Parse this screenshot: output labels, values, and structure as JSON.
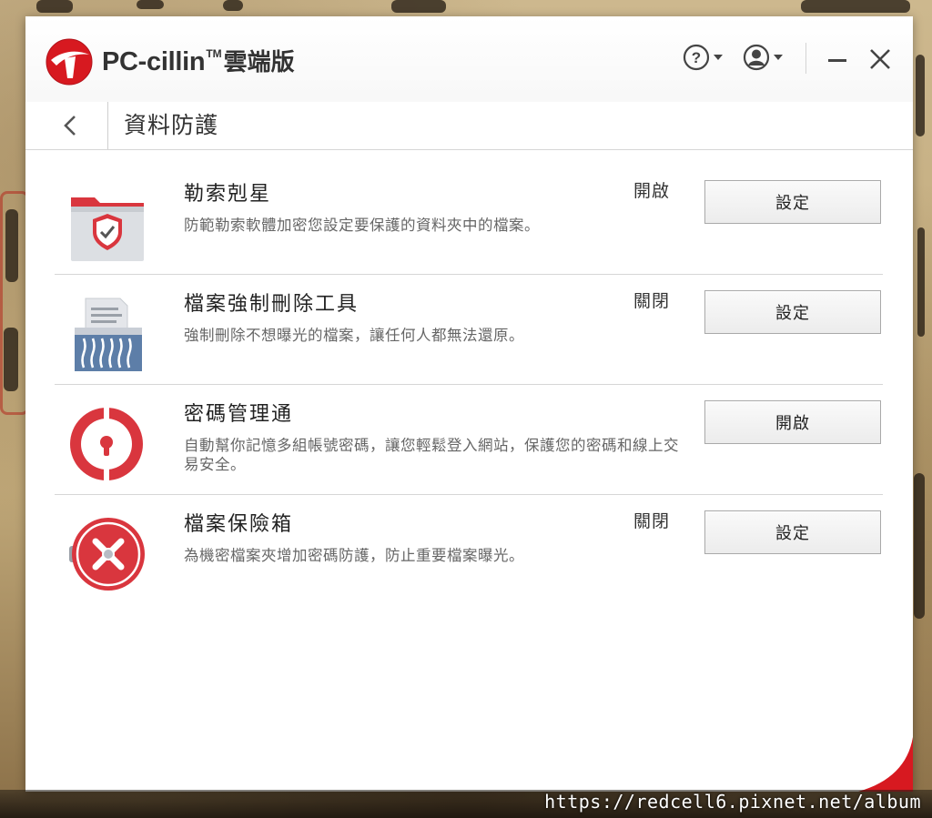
{
  "app": {
    "brand_name": "PC-cillin",
    "brand_tm": "TM",
    "brand_cn": "雲端版",
    "accent_color": "#d71920"
  },
  "titlebar": {
    "help_icon": "question-circle-icon",
    "account_icon": "user-circle-icon",
    "minimize_icon": "minimize-icon",
    "close_icon": "close-icon"
  },
  "subheader": {
    "back_icon": "chevron-left-icon",
    "title": "資料防護"
  },
  "features": [
    {
      "title": "勒索剋星",
      "description": "防範勒索軟體加密您設定要保護的資料夾中的檔案。",
      "status": "開啟",
      "button_label": "設定",
      "icon": "folder-shield-icon"
    },
    {
      "title": "檔案強制刪除工具",
      "description": "強制刪除不想曝光的檔案，讓任何人都無法還原。",
      "status": "關閉",
      "button_label": "設定",
      "icon": "file-shredder-icon"
    },
    {
      "title": "密碼管理通",
      "description": "自動幫你記憶多組帳號密碼，讓您輕鬆登入網站，保護您的密碼和線上交易安全。",
      "status": "",
      "button_label": "開啟",
      "icon": "password-manager-icon"
    },
    {
      "title": "檔案保險箱",
      "description": "為機密檔案夾增加密碼防護，防止重要檔案曝光。",
      "status": "關閉",
      "button_label": "設定",
      "icon": "vault-icon"
    }
  ],
  "watermark": "https://redcell6.pixnet.net/album"
}
